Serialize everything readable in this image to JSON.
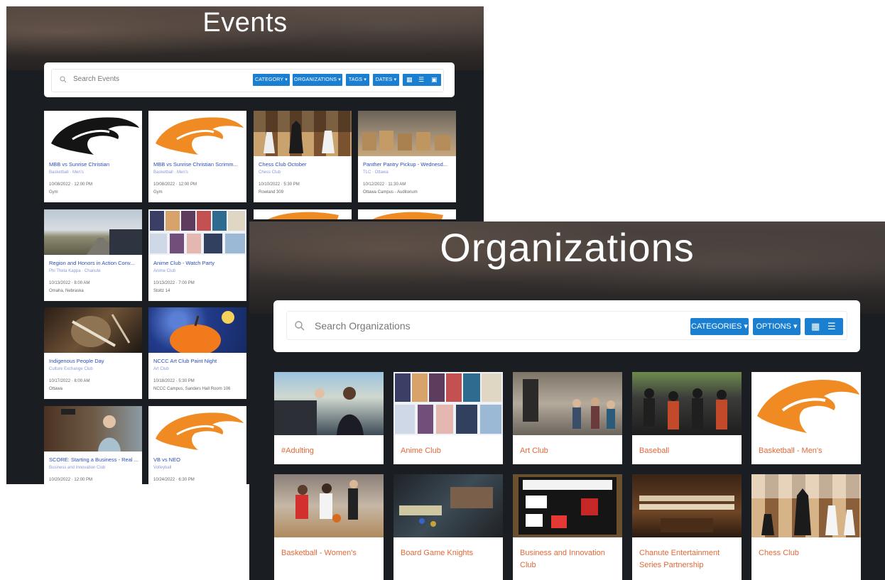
{
  "events": {
    "title": "Events",
    "search_placeholder": "Search Events",
    "filters": [
      "CATEGORY ▾",
      "ORGANIZATIONS ▾",
      "TAGS ▾",
      "DATES ▾"
    ],
    "cards": [
      {
        "title": "MBB vs Sunrise Christian",
        "sub": "Basketball · Men's",
        "date": "10/08/2022 · 12:00 PM",
        "loc": "Gym"
      },
      {
        "title": "MBB vs Sunrise Christian Scrimm...",
        "sub": "Basketball · Men's",
        "date": "10/08/2022 · 12:00 PM",
        "loc": "Gym"
      },
      {
        "title": "Chess Club October",
        "sub": "Chess Club",
        "date": "10/10/2022 · 5:30 PM",
        "loc": "Rowland 309"
      },
      {
        "title": "Panther Pantry Pickup - Wednesd...",
        "sub": "TLC · Ottawa",
        "date": "10/12/2022 · 11:30 AM",
        "loc": "Ottawa Campus - Auditorium"
      },
      {
        "title": "Region and Honors in Action Conv...",
        "sub": "Phi Theta Kappa · Chanute",
        "date": "10/13/2022 · 8:00 AM",
        "loc": "Omaha, Nebraska"
      },
      {
        "title": "Anime Club - Watch Party",
        "sub": "Anime Club",
        "date": "10/13/2022 · 7:00 PM",
        "loc": "Stoltz 14"
      },
      {
        "title": "Indigenous People Day",
        "sub": "Culture Exchange Club",
        "date": "10/17/2022 · 8:00 AM",
        "loc": "Ottawa"
      },
      {
        "title": "NCCC Art Club Paint Night",
        "sub": "Art Club",
        "date": "10/18/2022 · 5:30 PM",
        "loc": "NCCC Campus, Sanders Hall Room 106"
      },
      {
        "title": "SCORE: Starting a Business - Real ...",
        "sub": "Business and Innovation Club",
        "date": "10/20/2022 · 12:00 PM",
        "loc": ""
      },
      {
        "title": "VB vs NEO",
        "sub": "Volleyball",
        "date": "10/24/2022 · 6:30 PM",
        "loc": ""
      }
    ]
  },
  "organizations": {
    "title": "Organizations",
    "search_placeholder": "Search Organizations",
    "buttons": [
      "CATEGORIES ▾",
      "OPTIONS ▾"
    ],
    "items": [
      {
        "name": "#Adulting"
      },
      {
        "name": "Anime Club"
      },
      {
        "name": "Art Club"
      },
      {
        "name": "Baseball"
      },
      {
        "name": "Basketball - Men's"
      },
      {
        "name": "Basketball - Women's"
      },
      {
        "name": "Board Game Knights"
      },
      {
        "name": "Business and Innovation Club"
      },
      {
        "name": "Chanute Entertainment Series Partnership"
      },
      {
        "name": "Chess Club"
      }
    ]
  },
  "colors": {
    "accent": "#1a7fd1",
    "org_name": "#e2693a",
    "panther_orange": "#f08a22",
    "event_title": "#2b4fb5"
  }
}
